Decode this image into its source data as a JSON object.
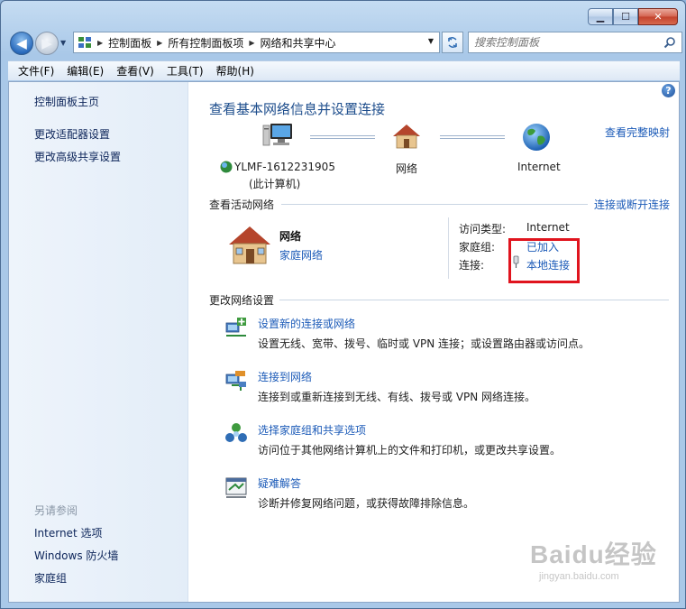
{
  "colors": {
    "link": "#1c5bb8",
    "title": "#1d4d8c",
    "highlight": "#e0141e",
    "sidebar_bg": "#e9f1fa"
  },
  "caption": {
    "minimize": "▁",
    "maximize": "☐",
    "close": "✕"
  },
  "nav": {
    "breadcrumbs": [
      "控制面板",
      "所有控制面板项",
      "网络和共享中心"
    ],
    "search_placeholder": "搜索控制面板"
  },
  "menu": [
    "文件(F)",
    "编辑(E)",
    "查看(V)",
    "工具(T)",
    "帮助(H)"
  ],
  "sidebar": {
    "links": [
      "控制面板主页",
      "更改适配器设置",
      "更改高级共享设置"
    ],
    "see_also_heading": "另请参阅",
    "see_also": [
      "Internet 选项",
      "Windows 防火墙",
      "家庭组"
    ]
  },
  "main": {
    "title": "查看基本网络信息并设置连接",
    "full_map_link": "查看完整映射",
    "map": {
      "computer_name": "YLMF-1612231905",
      "computer_sub": "(此计算机)",
      "network": "网络",
      "internet": "Internet"
    },
    "active_heading": "查看活动网络",
    "connect_link": "连接或断开连接",
    "active": {
      "name": "网络",
      "type": "家庭网络",
      "access_label": "访问类型:",
      "access_value": "Internet",
      "homegroup_label": "家庭组:",
      "homegroup_value": "已加入",
      "connection_label": "连接:",
      "connection_value": "本地连接"
    },
    "change_heading": "更改网络设置",
    "tasks": [
      {
        "icon": "new-connection-icon",
        "title": "设置新的连接或网络",
        "desc": "设置无线、宽带、拨号、临时或 VPN 连接；或设置路由器或访问点。"
      },
      {
        "icon": "connect-network-icon",
        "title": "连接到网络",
        "desc": "连接到或重新连接到无线、有线、拨号或 VPN 网络连接。"
      },
      {
        "icon": "homegroup-icon",
        "title": "选择家庭组和共享选项",
        "desc": "访问位于其他网络计算机上的文件和打印机，或更改共享设置。"
      },
      {
        "icon": "troubleshoot-icon",
        "title": "疑难解答",
        "desc": "诊断并修复网络问题，或获得故障排除信息。"
      }
    ]
  },
  "watermark": {
    "brand": "Baidu经验",
    "url": "jingyan.baidu.com"
  }
}
